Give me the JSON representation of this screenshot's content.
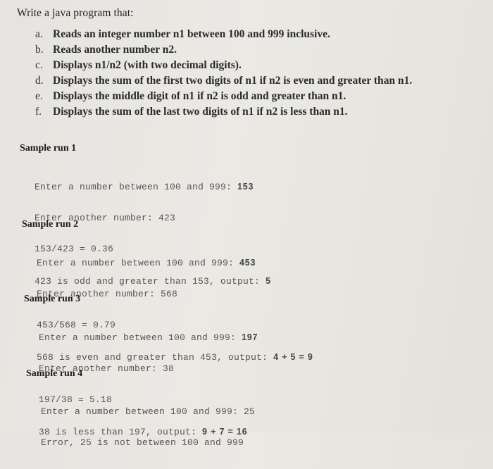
{
  "intro": "Write a java program that:",
  "requirements": [
    {
      "letter": "a.",
      "text": "Reads an integer number n1 between 100 and 999 inclusive."
    },
    {
      "letter": "b.",
      "text": "Reads another number n2."
    },
    {
      "letter": "c.",
      "text": "Displays n1/n2 (with two decimal digits)."
    },
    {
      "letter": "d.",
      "text": "Displays the sum of the first two digits of n1 if n2 is even and greater than n1."
    },
    {
      "letter": "e.",
      "text": "Displays the middle digit of n1 if n2 is odd and greater than n1."
    },
    {
      "letter": "f.",
      "text": "Displays the sum of the last two digits of n1 if n2 is less than n1."
    }
  ],
  "sample_runs": [
    {
      "title": "Sample run 1",
      "lines": [
        {
          "prompt": "Enter a number between 100 and 999: ",
          "input": "153"
        },
        {
          "prompt": "Enter another number: ",
          "input": "423"
        },
        {
          "prompt": "153/423 = 0.36",
          "input": ""
        },
        {
          "prompt": "423 is odd and greater than 153, output: ",
          "input": "5"
        }
      ]
    },
    {
      "title": "Sample run 2",
      "lines": [
        {
          "prompt": "Enter a number between 100 and 999: ",
          "input": "453"
        },
        {
          "prompt": "Enter another number: ",
          "input": "568"
        },
        {
          "prompt": "453/568 = 0.79",
          "input": ""
        },
        {
          "prompt": "568 is even and greater than 453, output: ",
          "input": "4 + 5 = 9"
        }
      ]
    },
    {
      "title": "Sample run 3",
      "lines": [
        {
          "prompt": "Enter a number between 100 and 999: ",
          "input": "197"
        },
        {
          "prompt": "Enter another number: ",
          "input": "38"
        },
        {
          "prompt": "197/38 = 5.18",
          "input": ""
        },
        {
          "prompt": "38 is less than 197, output: ",
          "input": "9 + 7 = 16"
        }
      ]
    },
    {
      "title": "Sample run 4",
      "lines": [
        {
          "prompt": "Enter a number between 100 and 999: ",
          "input": "25"
        },
        {
          "prompt": "Error, 25 is not between 100 and 999",
          "input": ""
        }
      ]
    }
  ]
}
